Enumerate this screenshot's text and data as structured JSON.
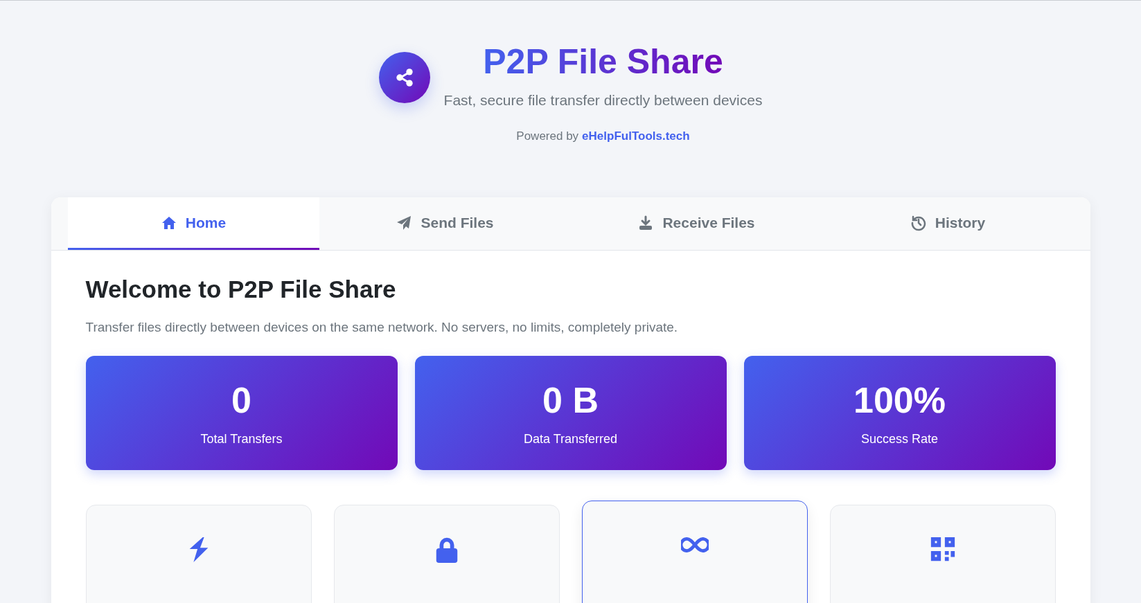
{
  "header": {
    "title": "P2P File Share",
    "subtitle": "Fast, secure file transfer directly between devices",
    "powered_prefix": "Powered by",
    "powered_link": "eHelpFulTools.tech"
  },
  "tabs": [
    {
      "label": "Home",
      "kind": "home",
      "selected": true
    },
    {
      "label": "Send Files",
      "kind": "send",
      "selected": false
    },
    {
      "label": "Receive Files",
      "kind": "receive",
      "selected": false
    },
    {
      "label": "History",
      "kind": "history",
      "selected": false
    }
  ],
  "welcome": {
    "heading": "Welcome to P2P File Share",
    "text": "Transfer files directly between devices on the same network. No servers, no limits, completely private."
  },
  "stats": [
    {
      "value": "0",
      "label": "Total Transfers"
    },
    {
      "value": "0 B",
      "label": "Data Transferred"
    },
    {
      "value": "100%",
      "label": "Success Rate"
    }
  ],
  "features": [
    {
      "kind": "bolt",
      "hovered": false
    },
    {
      "kind": "lock",
      "hovered": false
    },
    {
      "kind": "infinity",
      "hovered": true
    },
    {
      "kind": "qr",
      "hovered": false
    }
  ]
}
